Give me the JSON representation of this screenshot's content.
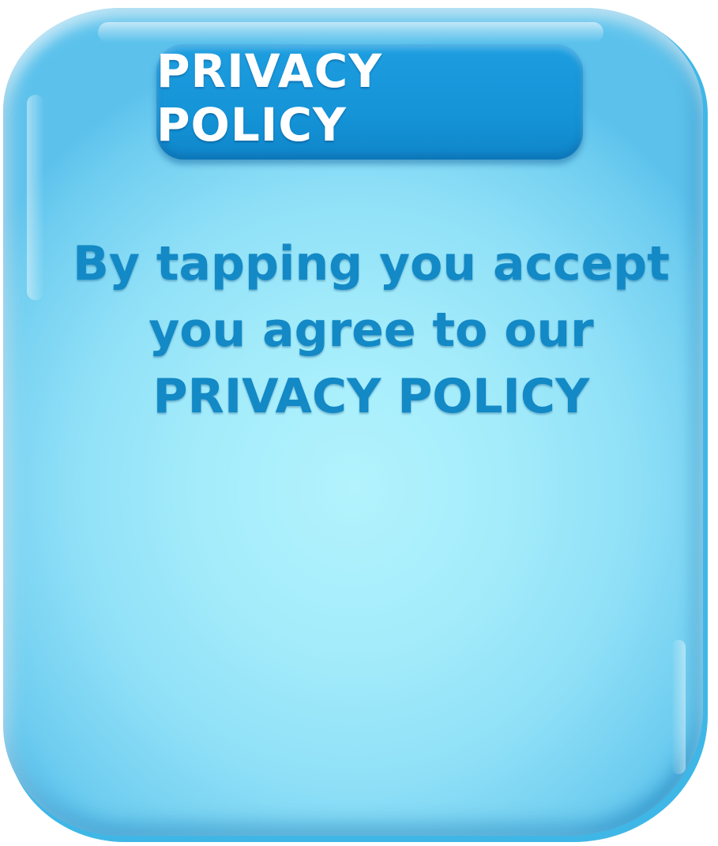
{
  "dialog": {
    "title": "PRIVACY POLICY",
    "message_lines": [
      "By tapping you accept",
      "you agree to our",
      "PRIVACY POLICY"
    ]
  },
  "colors": {
    "panel_center": "#b2f3fd",
    "panel_edge": "#5cc2ec",
    "title_pill": "#1594d8",
    "title_text": "#ffffff",
    "message_text": "#1389c6"
  }
}
